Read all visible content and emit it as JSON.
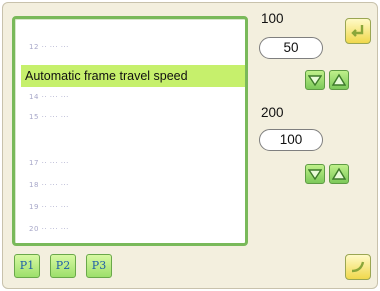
{
  "param_list": {
    "items": [
      "12 ·· ··· ···",
      "14 ·· ··· ···",
      "15 ·· ··· ···",
      "17 ·· ··· ···",
      "18 ·· ··· ···",
      "19 ·· ··· ···",
      "20 ·· ··· ···"
    ],
    "selected_label": "Automatic frame travel speed"
  },
  "setting_1": {
    "max_label": "100",
    "value": "50"
  },
  "setting_2": {
    "max_label": "200",
    "value": "100"
  },
  "pages": {
    "p1": "P1",
    "p2": "P2",
    "p3": "P3"
  },
  "icons": {
    "top_right": "enter-icon",
    "bottom_right": "return-icon",
    "down": "arrow-down-icon",
    "up": "arrow-up-icon"
  },
  "colors": {
    "selection": "#c6f06c",
    "panel_border": "#79b95a",
    "background": "#f3efde",
    "page_text": "#1f5ea8"
  }
}
